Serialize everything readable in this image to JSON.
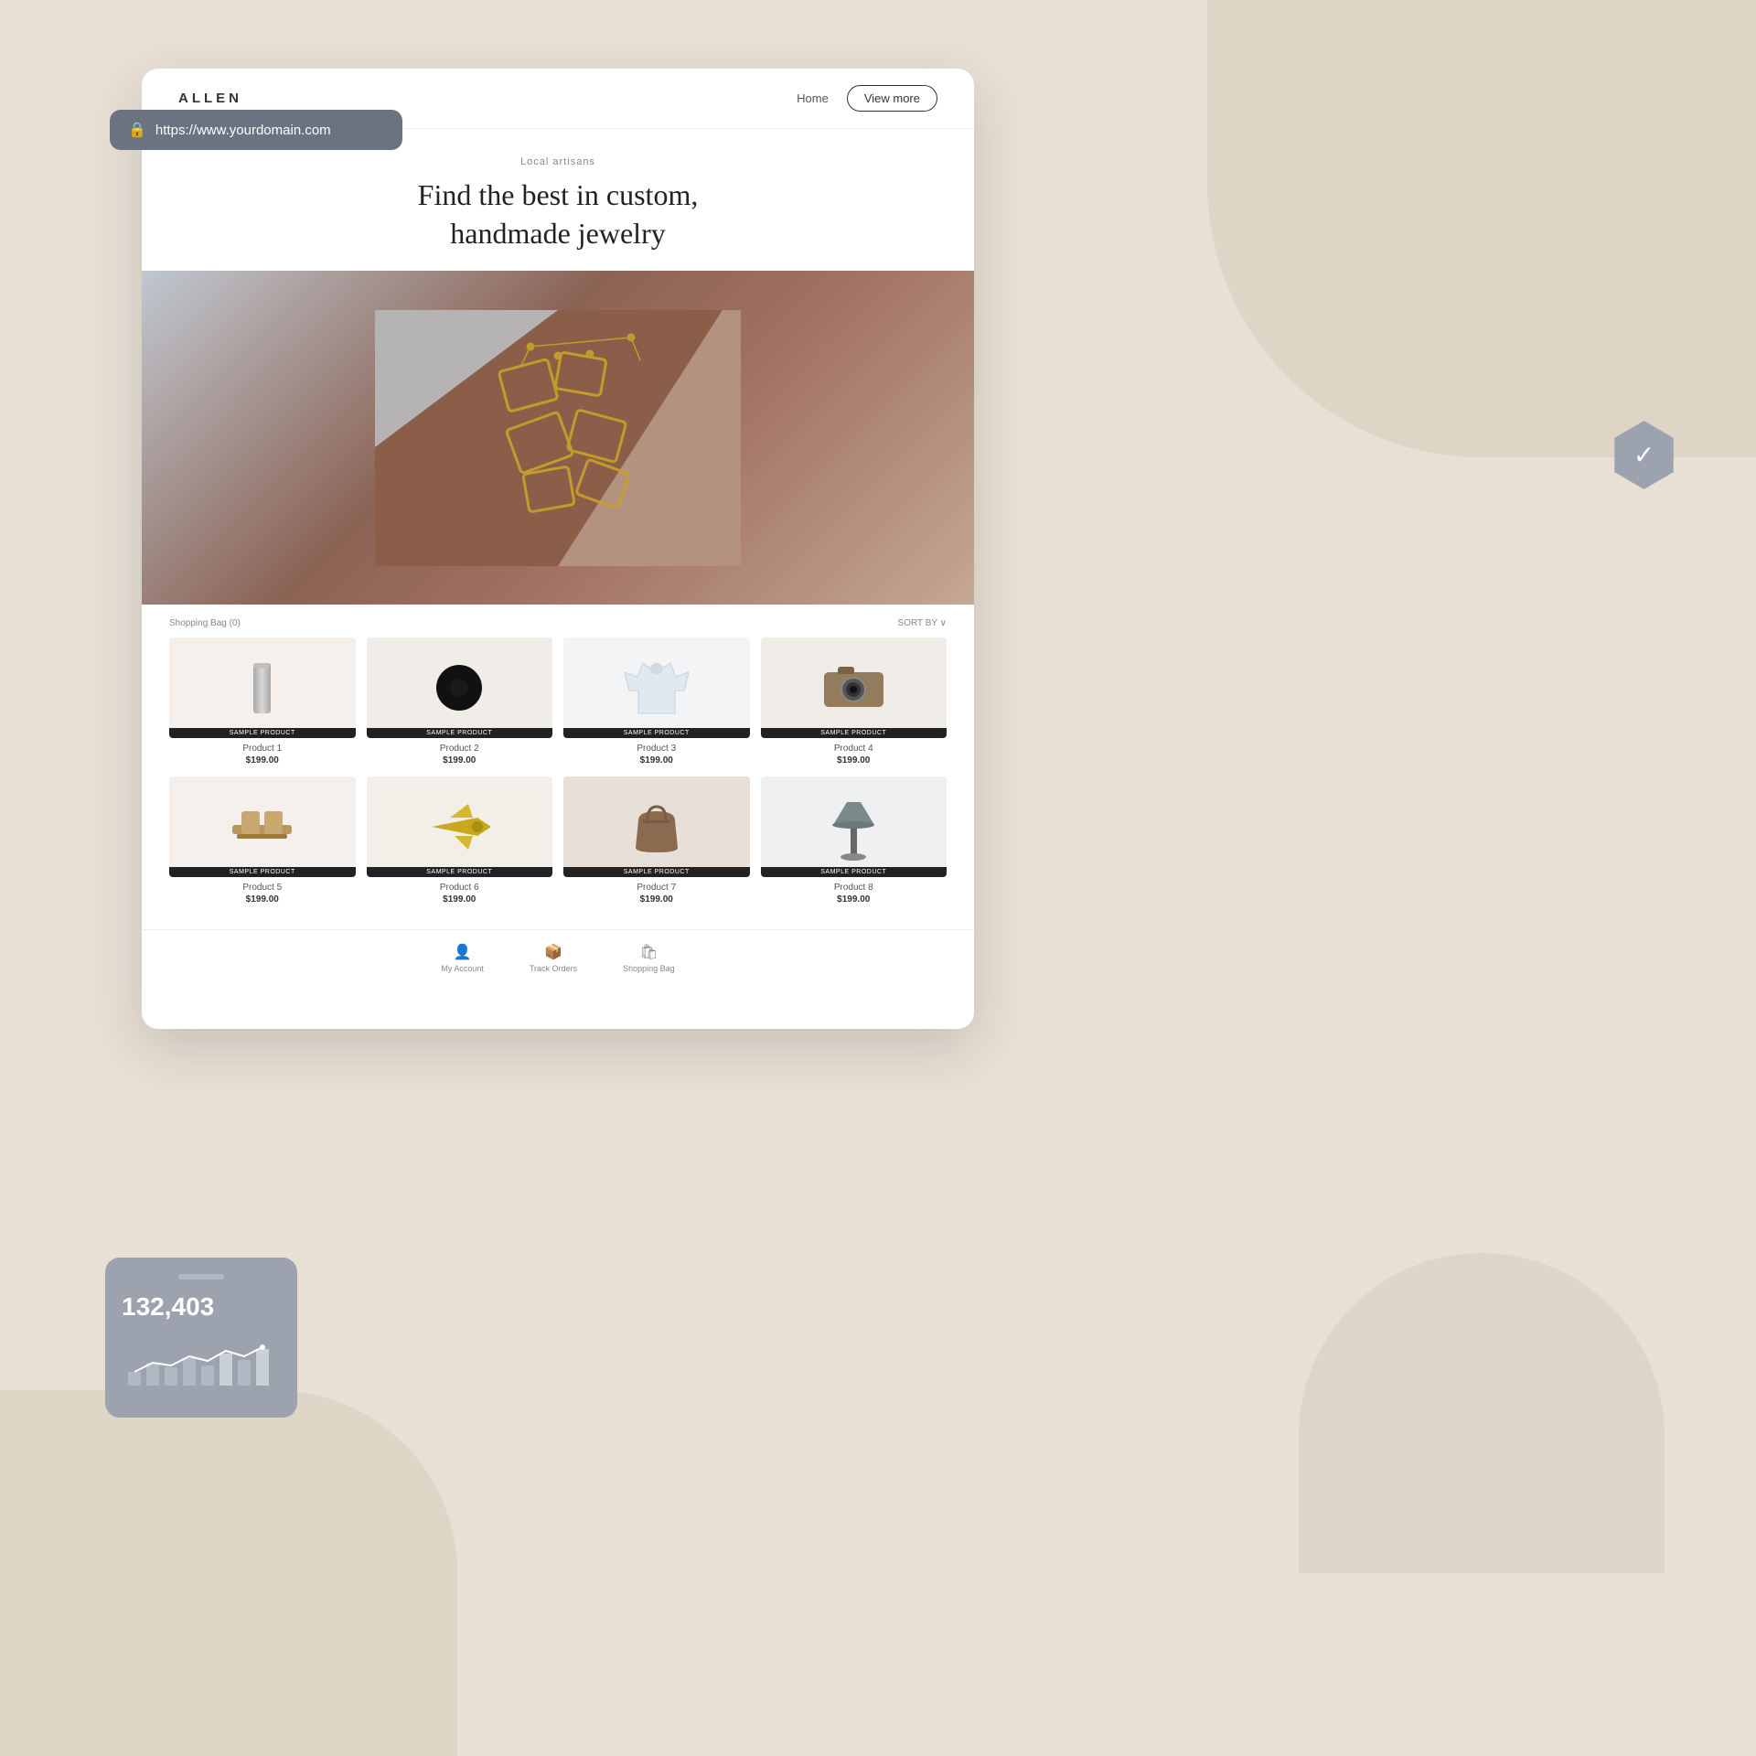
{
  "page": {
    "background": "#e8e0d5"
  },
  "browser": {
    "url": "https://www.yourdomain.com",
    "lock_icon": "🔒"
  },
  "site": {
    "logo": "ALLEN",
    "nav": {
      "home_link": "Home",
      "view_more_btn": "View more"
    },
    "hero": {
      "tagline": "Local artisans",
      "title_line1": "Find the best in custom,",
      "title_line2": "handmade jewelry"
    },
    "products_header": {
      "bag_label": "Shopping Bag (0)",
      "sort_label": "SORT BY ∨"
    },
    "products": [
      {
        "id": 1,
        "name": "Product 1",
        "price": "$199.00",
        "badge": "SAMPLE PRODUCT",
        "type": "tumbler"
      },
      {
        "id": 2,
        "name": "Product 2",
        "price": "$199.00",
        "badge": "SAMPLE PRODUCT",
        "type": "coffee"
      },
      {
        "id": 3,
        "name": "Product 3",
        "price": "$199.00",
        "badge": "SAMPLE PRODUCT",
        "type": "shirt"
      },
      {
        "id": 4,
        "name": "Product 4",
        "price": "$199.00",
        "badge": "SAMPLE PRODUCT",
        "type": "camera"
      },
      {
        "id": 5,
        "name": "Product 5",
        "price": "$199.00",
        "badge": "SAMPLE PRODUCT",
        "type": "cups"
      },
      {
        "id": 6,
        "name": "Product 6",
        "price": "$199.00",
        "badge": "SAMPLE PRODUCT",
        "type": "plane"
      },
      {
        "id": 7,
        "name": "Product 7",
        "price": "$199.00",
        "badge": "SAMPLE PRODUCT",
        "type": "bag"
      },
      {
        "id": 8,
        "name": "Product 8",
        "price": "$199.00",
        "badge": "SAMPLE PRODUCT",
        "type": "lamp"
      }
    ],
    "footer": {
      "items": [
        {
          "label": "My Account",
          "icon": "👤"
        },
        {
          "label": "Track Orders",
          "icon": "📦"
        },
        {
          "label": "Shopping Bag",
          "icon": "🛍"
        }
      ]
    }
  },
  "stats_card": {
    "number": "132,403",
    "bars": [
      15,
      25,
      20,
      30,
      22,
      35,
      28,
      40
    ]
  }
}
